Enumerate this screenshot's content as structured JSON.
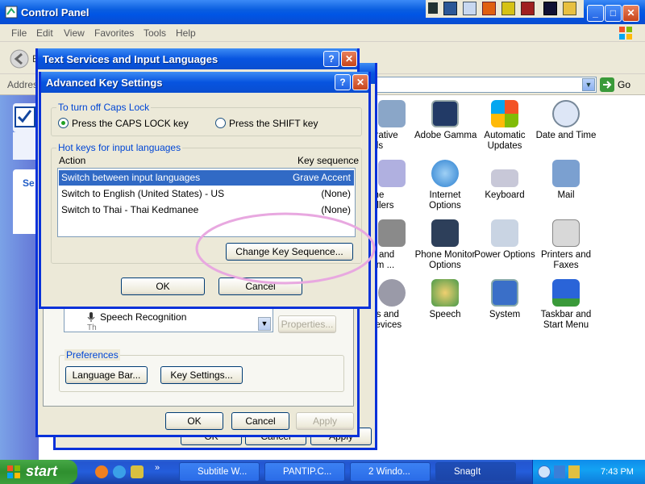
{
  "control_panel": {
    "title": "Control Panel",
    "menu": [
      "File",
      "Edit",
      "View",
      "Favorites",
      "Tools",
      "Help"
    ],
    "back_label": "B",
    "address_label": "Addres",
    "go_label": "Go",
    "side_letters": "Se",
    "icons": [
      {
        "label": "istrative\nools",
        "icon": "admin-tools-icon"
      },
      {
        "label": "Adobe Gamma",
        "icon": "adobe-gamma-icon"
      },
      {
        "label": "Automatic\nUpdates",
        "icon": "automatic-updates-icon"
      },
      {
        "label": "Date and Time",
        "icon": "date-time-icon"
      },
      {
        "label": "ame\ntrollers",
        "icon": "game-controllers-icon"
      },
      {
        "label": "Internet\nOptions",
        "icon": "internet-options-icon"
      },
      {
        "label": "Keyboard",
        "icon": "keyboard-icon"
      },
      {
        "label": "Mail",
        "icon": "mail-icon"
      },
      {
        "label": "ne and\ndem ...",
        "icon": "phone-modem-icon"
      },
      {
        "label": "Phone Monitor\nOptions",
        "icon": "phone-monitor-icon"
      },
      {
        "label": "Power Options",
        "icon": "power-options-icon"
      },
      {
        "label": "Printers and\nFaxes",
        "icon": "printers-faxes-icon"
      },
      {
        "label": "nds and\n Devices",
        "icon": "sounds-devices-icon"
      },
      {
        "label": "Speech",
        "icon": "speech-icon"
      },
      {
        "label": "System",
        "icon": "system-icon"
      },
      {
        "label": "Taskbar and\nStart Menu",
        "icon": "taskbar-start-icon"
      }
    ]
  },
  "text_services": {
    "title": "Text Services and Input Languages",
    "installed_item": "Speech Recognition",
    "installed_item_next": "Th",
    "properties_label": "Properties...",
    "preferences_label": "Preferences",
    "language_bar_label": "Language Bar...",
    "key_settings_label": "Key Settings...",
    "ok_label": "OK",
    "cancel_label": "Cancel",
    "apply_label": "Apply"
  },
  "advanced_key": {
    "title": "Advanced Key Settings",
    "caps_group_label": "To turn off Caps Lock",
    "caps_option_1": "Press the CAPS LOCK key",
    "caps_option_2": "Press the SHIFT key",
    "caps_selected": 1,
    "hotkeys_group_label": "Hot keys for input languages",
    "col_action": "Action",
    "col_key": "Key sequence",
    "rows": [
      {
        "action": "Switch between input languages",
        "key": "Grave Accent",
        "selected": true
      },
      {
        "action": "Switch to English (United States) - US",
        "key": "(None)",
        "selected": false
      },
      {
        "action": "Switch to Thai - Thai Kedmanee",
        "key": "(None)",
        "selected": false
      }
    ],
    "change_key_label": "Change Key Sequence...",
    "ok_label": "OK",
    "cancel_label": "Cancel"
  },
  "taskbar": {
    "start_label": "start",
    "tasks": [
      {
        "label": "Subtitle W...",
        "active": false
      },
      {
        "label": "PANTIP.C...",
        "active": false
      },
      {
        "label": "2 Windo...",
        "active": false
      },
      {
        "label": "SnagIt",
        "active": true
      }
    ],
    "clock": "7:43 PM"
  },
  "colors": {
    "accent": "#0054e3",
    "selection": "#316ac5",
    "annotation": "#e8a8e0"
  }
}
